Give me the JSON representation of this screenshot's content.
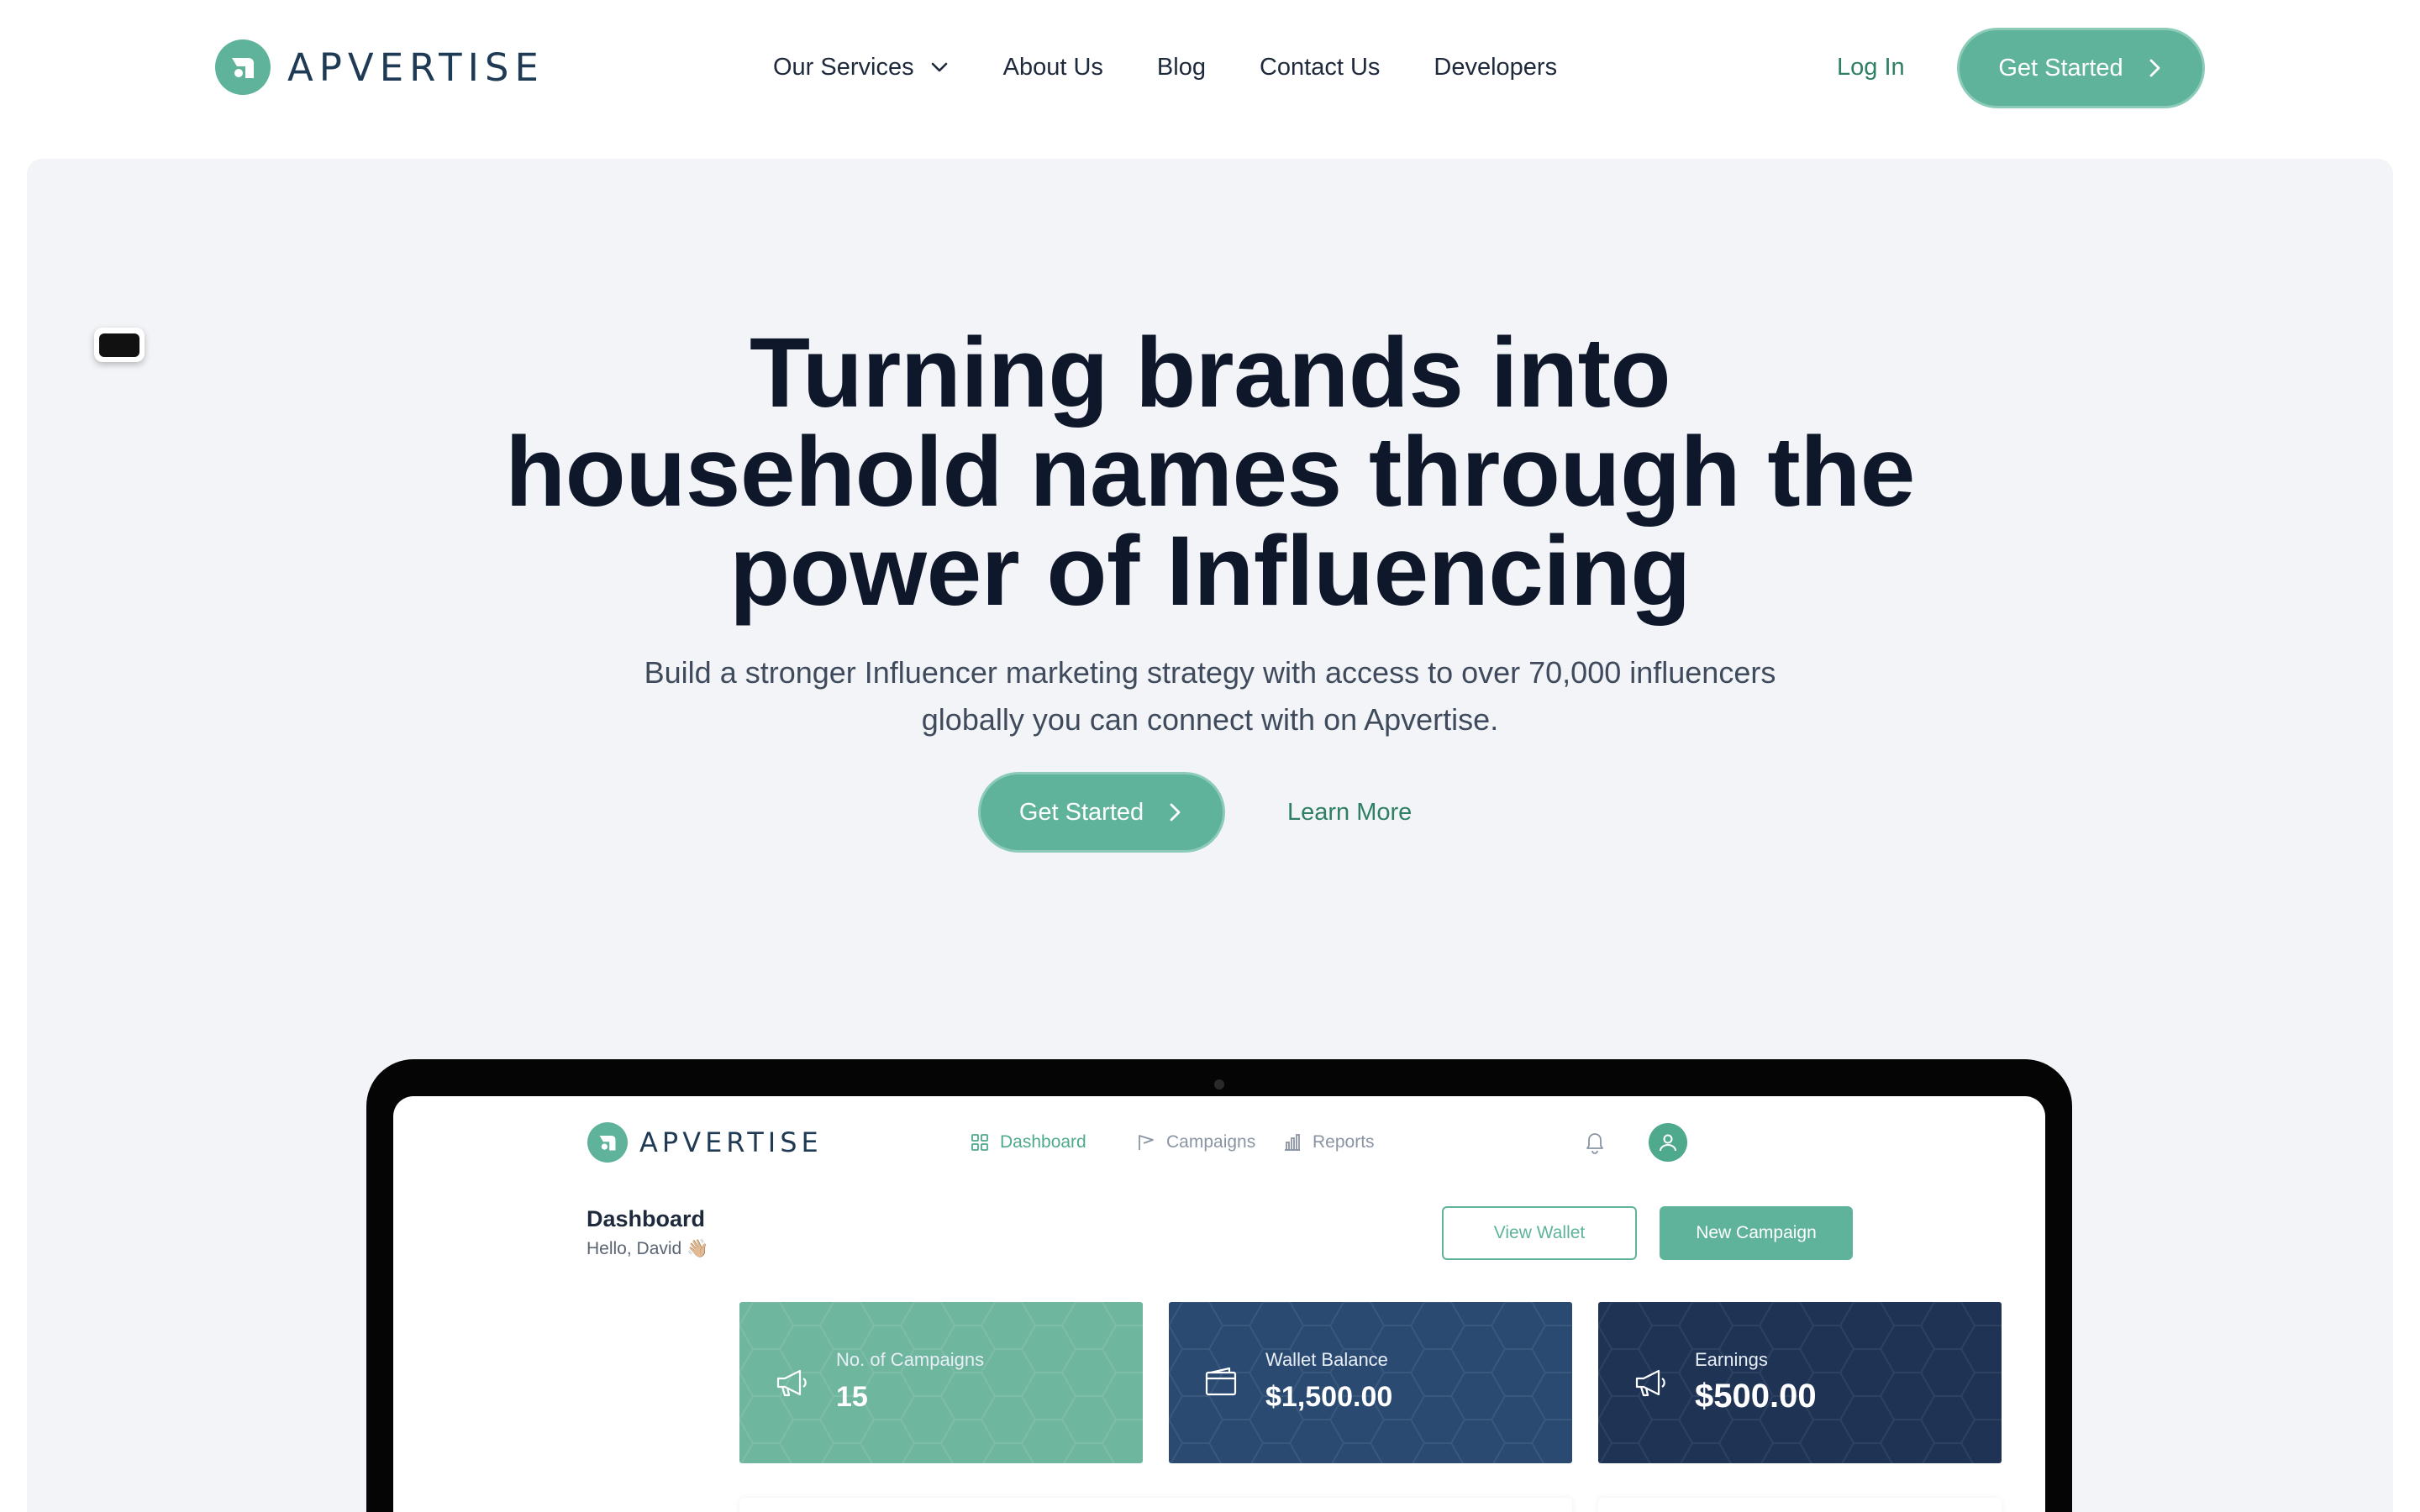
{
  "brand": {
    "name": "APVERTISE"
  },
  "nav": {
    "links": [
      "Our Services",
      "About Us",
      "Blog",
      "Contact Us",
      "Developers"
    ],
    "login": "Log In",
    "cta": "Get Started"
  },
  "hero": {
    "headline": [
      "Turning brands into",
      "household names through the",
      "power of Influencing"
    ],
    "subtitle": [
      "Build a stronger Influencer marketing strategy with access to over 70,000 influencers",
      "globally you can connect with on Apvertise."
    ],
    "cta": "Get Started",
    "secondary": "Learn More"
  },
  "app": {
    "brand": "APVERTISE",
    "nav": [
      "Dashboard",
      "Campaigns",
      "Reports"
    ],
    "active_nav": "Dashboard",
    "title": "Dashboard",
    "greeting": "Hello, David 👋🏼",
    "view_wallet": "View Wallet",
    "new_campaign": "New Campaign",
    "stats": [
      {
        "label": "No. of Campaigns",
        "value": "15",
        "icon": "megaphone-icon"
      },
      {
        "label": "Wallet Balance",
        "value": "$1,500.00",
        "icon": "wallet-icon"
      },
      {
        "label": "Earnings",
        "value": "$500.00",
        "icon": "megaphone-icon"
      }
    ]
  },
  "colors": {
    "accent": "#5fb39a",
    "accent_text": "#2f7f62",
    "heading": "#0f172a",
    "hero_bg": "#f2f4f7",
    "stat_teal": "#6fb69e",
    "stat_navy": "#2b4a72",
    "stat_dark": "#1f3354"
  }
}
